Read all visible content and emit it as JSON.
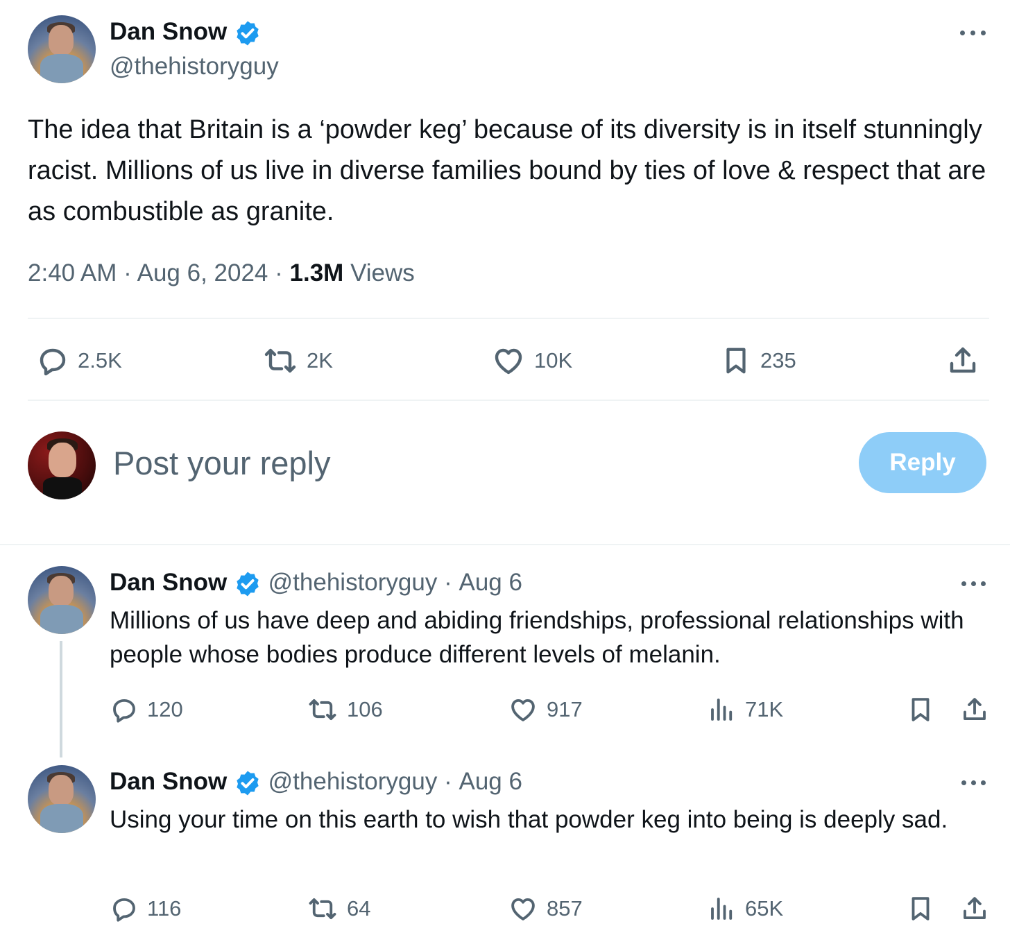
{
  "main_tweet": {
    "author_name": "Dan Snow",
    "author_handle": "@thehistoryguy",
    "text": "The idea that Britain is a ‘powder keg’ because of its diversity is in itself stunningly racist. Millions of us live in diverse families bound by ties of love & respect that are as combustible as granite.",
    "time": "2:40 AM",
    "date": "Aug 6, 2024",
    "views_count": "1.3M",
    "views_label": "Views",
    "replies": "2.5K",
    "reposts": "2K",
    "likes": "10K",
    "bookmarks": "235"
  },
  "composer": {
    "placeholder": "Post your reply",
    "button_label": "Reply"
  },
  "replies": [
    {
      "author_name": "Dan Snow",
      "author_handle": "@thehistoryguy",
      "date": "Aug 6",
      "text": "Millions of us have deep and abiding friendships, professional relationships with people whose bodies produce different levels of melanin.",
      "replies": "120",
      "reposts": "106",
      "likes": "917",
      "views": "71K"
    },
    {
      "author_name": "Dan Snow",
      "author_handle": "@thehistoryguy",
      "date": "Aug 6",
      "text": "Using your time on this earth to wish that powder keg into being is deeply sad.",
      "replies": "116",
      "reposts": "64",
      "likes": "857",
      "views": "65K"
    }
  ],
  "separator": "·",
  "colors": {
    "verified": "#1d9bf0",
    "muted": "#536471",
    "reply_button": "#8ecdf8"
  }
}
